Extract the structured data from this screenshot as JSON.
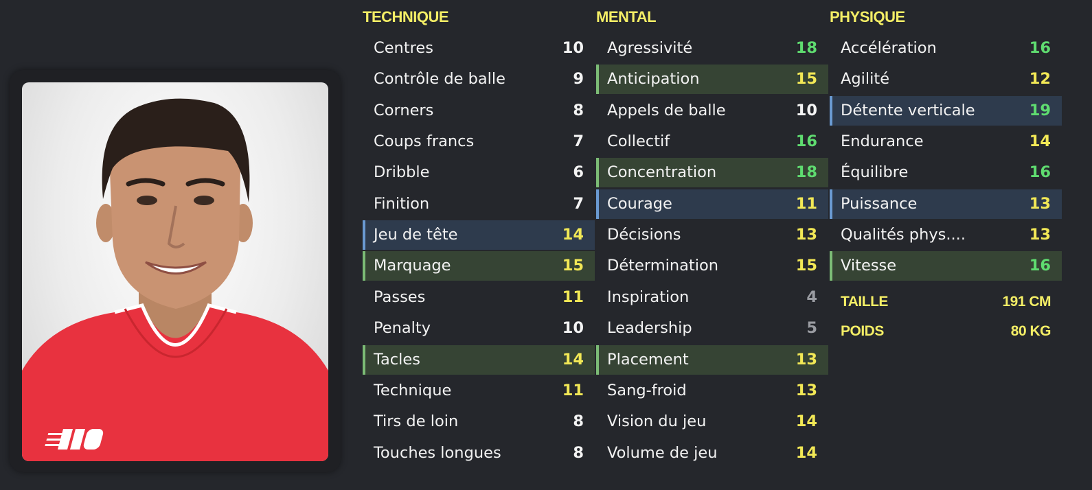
{
  "player_photo": {
    "shirt_color": "#e8323f",
    "sponsor_logo": "nb-logo"
  },
  "technique": {
    "title": "TECHNIQUE",
    "attributes": [
      {
        "label": "Centres",
        "value": "10",
        "color": "white",
        "highlight": "none"
      },
      {
        "label": "Contrôle de balle",
        "value": "9",
        "color": "white",
        "highlight": "none"
      },
      {
        "label": "Corners",
        "value": "8",
        "color": "white",
        "highlight": "none"
      },
      {
        "label": "Coups francs",
        "value": "7",
        "color": "white",
        "highlight": "none"
      },
      {
        "label": "Dribble",
        "value": "6",
        "color": "white",
        "highlight": "none"
      },
      {
        "label": "Finition",
        "value": "7",
        "color": "white",
        "highlight": "none"
      },
      {
        "label": "Jeu de tête",
        "value": "14",
        "color": "yellow",
        "highlight": "blue"
      },
      {
        "label": "Marquage",
        "value": "15",
        "color": "yellow",
        "highlight": "green"
      },
      {
        "label": "Passes",
        "value": "11",
        "color": "yellow",
        "highlight": "none"
      },
      {
        "label": "Penalty",
        "value": "10",
        "color": "white",
        "highlight": "none"
      },
      {
        "label": "Tacles",
        "value": "14",
        "color": "yellow",
        "highlight": "green"
      },
      {
        "label": "Technique",
        "value": "11",
        "color": "yellow",
        "highlight": "none"
      },
      {
        "label": "Tirs de loin",
        "value": "8",
        "color": "white",
        "highlight": "none"
      },
      {
        "label": "Touches longues",
        "value": "8",
        "color": "white",
        "highlight": "none"
      }
    ]
  },
  "mental": {
    "title": "MENTAL",
    "attributes": [
      {
        "label": "Agressivité",
        "value": "18",
        "color": "green",
        "highlight": "none"
      },
      {
        "label": "Anticipation",
        "value": "15",
        "color": "yellow",
        "highlight": "green"
      },
      {
        "label": "Appels de balle",
        "value": "10",
        "color": "white",
        "highlight": "none"
      },
      {
        "label": "Collectif",
        "value": "16",
        "color": "green",
        "highlight": "none"
      },
      {
        "label": "Concentration",
        "value": "18",
        "color": "green",
        "highlight": "green"
      },
      {
        "label": "Courage",
        "value": "11",
        "color": "yellow",
        "highlight": "blue"
      },
      {
        "label": "Décisions",
        "value": "13",
        "color": "yellow",
        "highlight": "none"
      },
      {
        "label": "Détermination",
        "value": "15",
        "color": "yellow",
        "highlight": "none"
      },
      {
        "label": "Inspiration",
        "value": "4",
        "color": "grey",
        "highlight": "none"
      },
      {
        "label": "Leadership",
        "value": "5",
        "color": "grey",
        "highlight": "none"
      },
      {
        "label": "Placement",
        "value": "13",
        "color": "yellow",
        "highlight": "green"
      },
      {
        "label": "Sang-froid",
        "value": "13",
        "color": "yellow",
        "highlight": "none"
      },
      {
        "label": "Vision du jeu",
        "value": "14",
        "color": "yellow",
        "highlight": "none"
      },
      {
        "label": "Volume de jeu",
        "value": "14",
        "color": "yellow",
        "highlight": "none"
      }
    ]
  },
  "physique": {
    "title": "PHYSIQUE",
    "attributes": [
      {
        "label": "Accélération",
        "value": "16",
        "color": "green",
        "highlight": "none"
      },
      {
        "label": "Agilité",
        "value": "12",
        "color": "yellow",
        "highlight": "none"
      },
      {
        "label": "Détente verticale",
        "value": "19",
        "color": "green",
        "highlight": "blue"
      },
      {
        "label": "Endurance",
        "value": "14",
        "color": "yellow",
        "highlight": "none"
      },
      {
        "label": "Équilibre",
        "value": "16",
        "color": "green",
        "highlight": "none"
      },
      {
        "label": "Puissance",
        "value": "13",
        "color": "yellow",
        "highlight": "blue"
      },
      {
        "label": "Qualités phys....",
        "value": "13",
        "color": "yellow",
        "highlight": "none"
      },
      {
        "label": "Vitesse",
        "value": "16",
        "color": "green",
        "highlight": "green"
      }
    ],
    "info": [
      {
        "label": "TAILLE",
        "value": "191 CM"
      },
      {
        "label": "POIDS",
        "value": "80 KG"
      }
    ]
  },
  "colors": {
    "background": "#25272c",
    "header": "#f4ee66",
    "value_white": "#f4f4f4",
    "value_yellow": "#f2e856",
    "value_green": "#5fdc70",
    "value_grey": "#9a9ca2",
    "highlight_green": "#364434",
    "highlight_blue": "#2e3b4d"
  }
}
